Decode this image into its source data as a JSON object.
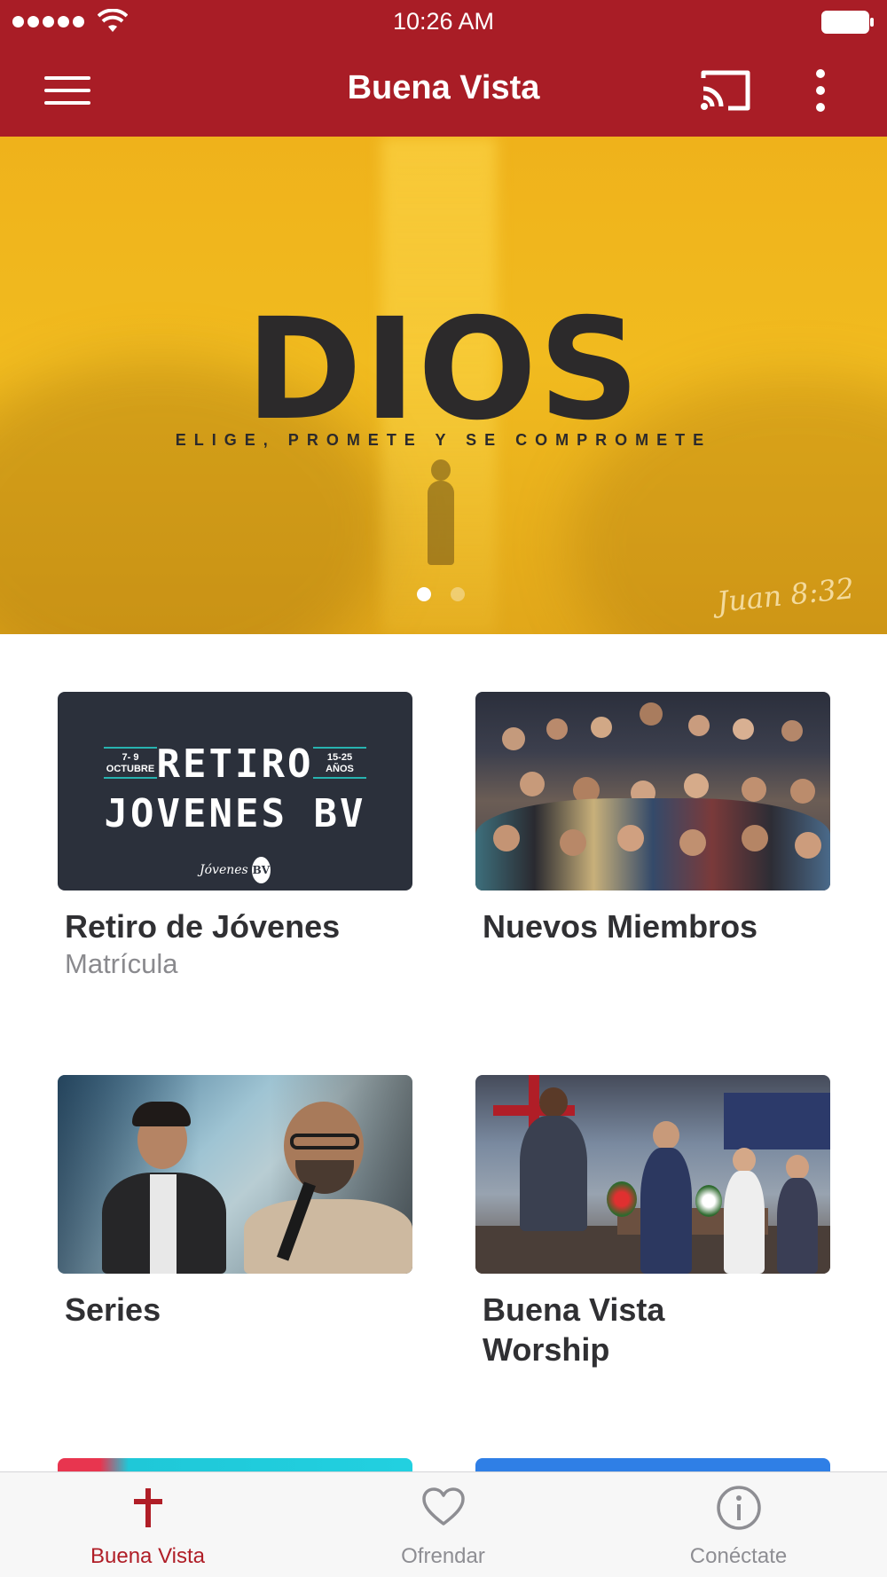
{
  "status_bar": {
    "time": "10:26 AM",
    "signal_icon": "signal-dots-icon",
    "wifi_icon": "wifi-icon",
    "battery_icon": "battery-full-icon"
  },
  "header": {
    "title": "Buena Vista",
    "menu_icon": "hamburger-menu-icon",
    "cast_icon": "cast-icon",
    "more_icon": "more-vertical-icon",
    "background_color": "#a91d26"
  },
  "hero": {
    "title": "DIOS",
    "subtitle": "ELIGE, PROMETE Y SE COMPROMETE",
    "verse": "Juan 8:32",
    "pages": 2,
    "current_page": 1
  },
  "cards": [
    {
      "title": "Retiro de Jóvenes",
      "subtitle": "Matrícula",
      "image_text": {
        "line1": "RETIRO",
        "line2": "JOVENES BV",
        "date": "7- 9 OCTUBRE",
        "ages": "15-25 AÑOS",
        "logo": "Jóvenes",
        "logo_mark": "BV"
      }
    },
    {
      "title": "Nuevos Miembros",
      "subtitle": ""
    },
    {
      "title": "Series",
      "subtitle": ""
    },
    {
      "title": "Buena Vista Worship",
      "subtitle": ""
    }
  ],
  "tab_bar": {
    "tabs": [
      {
        "label": "Buena Vista",
        "icon": "cross-icon",
        "active": true
      },
      {
        "label": "Ofrendar",
        "icon": "heart-icon",
        "active": false
      },
      {
        "label": "Conéctate",
        "icon": "info-icon",
        "active": false
      }
    ],
    "active_color": "#b01e27",
    "inactive_color": "#8e8e93"
  }
}
